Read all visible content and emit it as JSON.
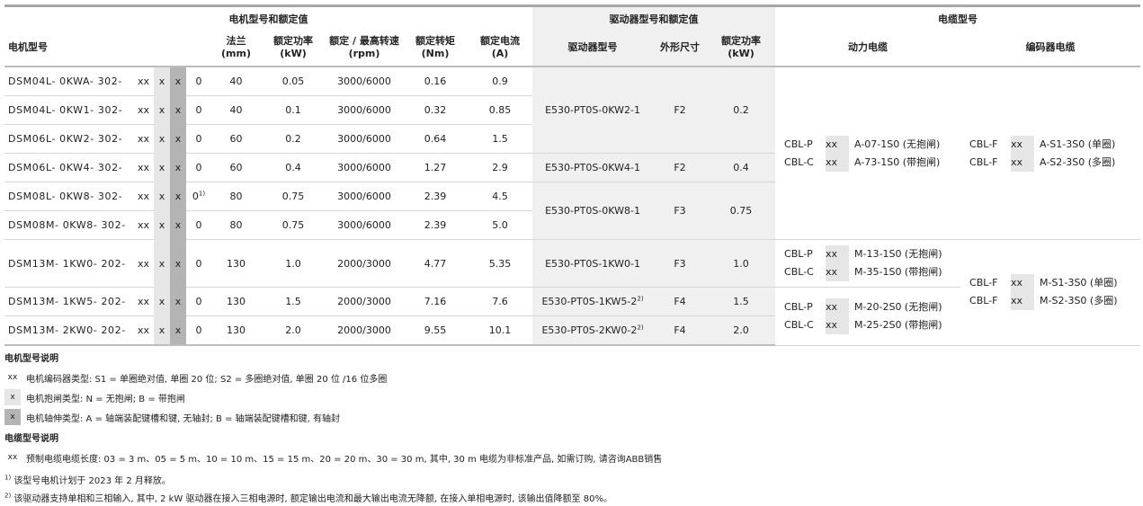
{
  "groups": {
    "motor": "电机型号和额定值",
    "drive": "驱动器型号和额定值",
    "cable": "电缆型号"
  },
  "headers": {
    "motor_model": "电机型号",
    "flange": [
      "法兰",
      "(mm)"
    ],
    "power": [
      "额定功率",
      "(kW)"
    ],
    "speed": [
      "额定 / 最高转速",
      "(rpm)"
    ],
    "torque": [
      "额定转矩",
      "(Nm)"
    ],
    "current": [
      "额定电流",
      "(A)"
    ],
    "drive_model": "驱动器型号",
    "frame": "外形尺寸",
    "drive_power": [
      "额定功率",
      "(kW)"
    ],
    "power_cable": "动力电缆",
    "encoder_cable": "编码器电缆"
  },
  "rows": [
    {
      "model": "DSM04L- 0KWA- 302-",
      "xx": "xx",
      "x1": "x",
      "x2": "x",
      "end": "0",
      "sup": "",
      "flange": "40",
      "power": "0.05",
      "speed": "3000/6000",
      "torque": "0.16",
      "current": "0.9"
    },
    {
      "model": "DSM04L- 0KW1- 302-",
      "xx": "xx",
      "x1": "x",
      "x2": "x",
      "end": "0",
      "sup": "",
      "flange": "40",
      "power": "0.1",
      "speed": "3000/6000",
      "torque": "0.32",
      "current": "0.85"
    },
    {
      "model": "DSM06L- 0KW2- 302-",
      "xx": "xx",
      "x1": "x",
      "x2": "x",
      "end": "0",
      "sup": "",
      "flange": "60",
      "power": "0.2",
      "speed": "3000/6000",
      "torque": "0.64",
      "current": "1.5"
    },
    {
      "model": "DSM06L- 0KW4- 302-",
      "xx": "xx",
      "x1": "x",
      "x2": "x",
      "end": "0",
      "sup": "",
      "flange": "60",
      "power": "0.4",
      "speed": "3000/6000",
      "torque": "1.27",
      "current": "2.9"
    },
    {
      "model": "DSM08L- 0KW8- 302-",
      "xx": "xx",
      "x1": "x",
      "x2": "x",
      "end": "0",
      "sup": "1)",
      "flange": "80",
      "power": "0.75",
      "speed": "3000/6000",
      "torque": "2.39",
      "current": "4.5"
    },
    {
      "model": "DSM08M- 0KW8- 302-",
      "xx": "xx",
      "x1": "x",
      "x2": "x",
      "end": "0",
      "sup": "",
      "flange": "80",
      "power": "0.75",
      "speed": "3000/6000",
      "torque": "2.39",
      "current": "5.0"
    },
    {
      "model": "DSM13M- 1KW0- 202-",
      "xx": "xx",
      "x1": "x",
      "x2": "x",
      "end": "0",
      "sup": "",
      "flange": "130",
      "power": "1.0",
      "speed": "2000/3000",
      "torque": "4.77",
      "current": "5.35"
    },
    {
      "model": "DSM13M- 1KW5- 202-",
      "xx": "xx",
      "x1": "x",
      "x2": "x",
      "end": "0",
      "sup": "",
      "flange": "130",
      "power": "1.5",
      "speed": "2000/3000",
      "torque": "7.16",
      "current": "7.6"
    },
    {
      "model": "DSM13M- 2KW0- 202-",
      "xx": "xx",
      "x1": "x",
      "x2": "x",
      "end": "0",
      "sup": "",
      "flange": "130",
      "power": "2.0",
      "speed": "2000/3000",
      "torque": "9.55",
      "current": "10.1"
    }
  ],
  "drives": [
    {
      "model": "E530-PT0S-0KW2-1",
      "sup": "",
      "frame": "F2",
      "power": "0.2"
    },
    {
      "model": "E530-PT0S-0KW4-1",
      "sup": "",
      "frame": "F2",
      "power": "0.4"
    },
    {
      "model": "E530-PT0S-0KW8-1",
      "sup": "",
      "frame": "F3",
      "power": "0.75"
    },
    {
      "model": "E530-PT0S-1KW0-1",
      "sup": "",
      "frame": "F3",
      "power": "1.0"
    },
    {
      "model": "E530-PT0S-1KW5-2",
      "sup": "2)",
      "frame": "F4",
      "power": "1.5"
    },
    {
      "model": "E530-PT0S-2KW0-2",
      "sup": "2)",
      "frame": "F4",
      "power": "2.0"
    }
  ],
  "cables": {
    "power_a": [
      {
        "pre": "CBL-P",
        "xx": "xx",
        "name": "A-07-1S0 (无抱闸)"
      },
      {
        "pre": "CBL-C",
        "xx": "xx",
        "name": "A-73-1S0 (带抱闸)"
      }
    ],
    "encoder_a": [
      {
        "pre": "CBL-F",
        "xx": "xx",
        "name": "A-S1-3S0 (单圈)"
      },
      {
        "pre": "CBL-F",
        "xx": "xx",
        "name": "A-S2-3S0 (多圈)"
      }
    ],
    "power_b": [
      {
        "pre": "CBL-P",
        "xx": "xx",
        "name": "M-13-1S0 (无抱闸)"
      },
      {
        "pre": "CBL-C",
        "xx": "xx",
        "name": "M-35-1S0 (带抱闸)"
      }
    ],
    "power_c": [
      {
        "pre": "CBL-P",
        "xx": "xx",
        "name": "M-20-2S0 (无抱闸)"
      },
      {
        "pre": "CBL-C",
        "xx": "xx",
        "name": "M-25-2S0 (带抱闸)"
      }
    ],
    "encoder_b": [
      {
        "pre": "CBL-F",
        "xx": "xx",
        "name": "M-S1-3S0 (单圈)"
      },
      {
        "pre": "CBL-F",
        "xx": "xx",
        "name": "M-S2-3S0 (多圈)"
      }
    ]
  },
  "notes": {
    "motor_title": "电机型号说明",
    "motor_items": [
      {
        "tag": "xx",
        "text": "电机编码器类型: S1 = 单圈绝对值, 单圈 20 位; S2 = 多圈绝对值, 单圈 20 位 /16 位多圈"
      },
      {
        "tag": "x",
        "text": "电机抱闸类型: N = 无抱闸; B = 带抱闸"
      },
      {
        "tag": "x",
        "text": "电机轴伸类型: A = 轴端装配键槽和键, 无轴封; B = 轴端装配键槽和键, 有轴封"
      }
    ],
    "cable_title": "电缆型号说明",
    "cable_items": [
      {
        "tag": "xx",
        "text": "预制电缆电缆长度: 03 = 3 m、05 = 5 m、10 = 10 m、15 = 15 m、20 = 20 m、30 = 30 m, 其中, 30 m 电缆为非标准产品, 如需订购, 请咨询ABB销售"
      }
    ],
    "footnotes": [
      {
        "mark": "1)",
        "text": "该型号电机计划于 2023 年 2 月释放。"
      },
      {
        "mark": "2)",
        "text": "该驱动器支持单相和三相输入, 其中, 2 kW 驱动器在接入三相电源时, 额定输出电流和最大输出电流无降额, 在接入单相电源时, 该输出值降额至 80%。"
      }
    ]
  }
}
